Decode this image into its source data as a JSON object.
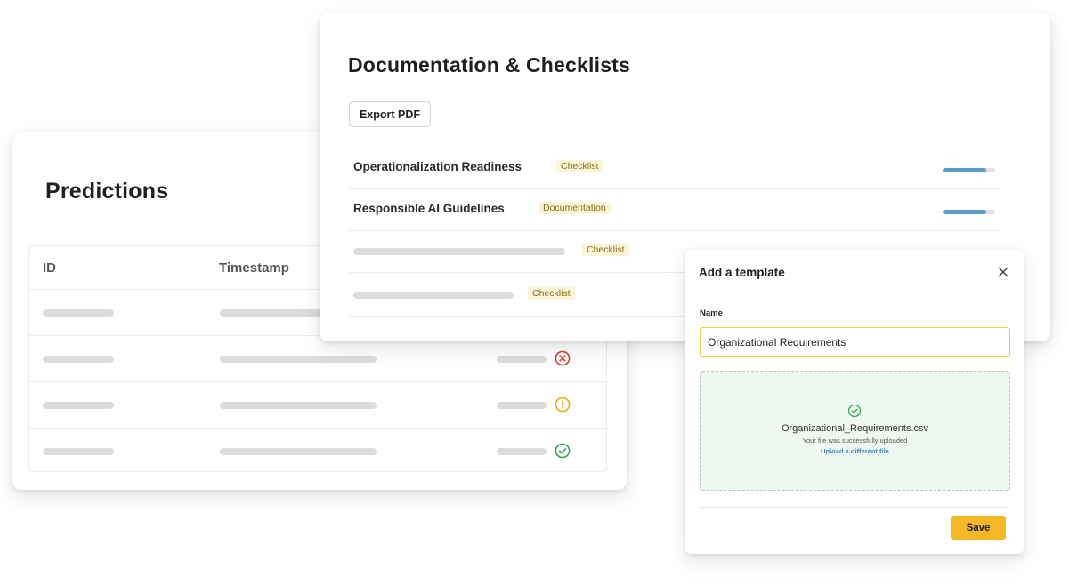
{
  "predictions": {
    "title": "Predictions",
    "columns": [
      "ID",
      "Timestamp"
    ],
    "rows": [
      {
        "status_icon": "none"
      },
      {
        "status_icon": "error-circle-icon"
      },
      {
        "status_icon": "warning-circle-icon"
      },
      {
        "status_icon": "check-circle-icon"
      }
    ]
  },
  "documentation": {
    "title": "Documentation & Checklists",
    "export_label": "Export PDF",
    "items": [
      {
        "label": "Operationalization Readiness",
        "tag": "Checklist",
        "progress": 0.83
      },
      {
        "label": "Responsible AI Guidelines",
        "tag": "Documentation",
        "progress": 0.83
      },
      {
        "label": "",
        "tag": "Checklist"
      },
      {
        "label": "",
        "tag": "Checklist"
      }
    ]
  },
  "modal": {
    "title": "Add a template",
    "name_label": "Name",
    "name_value": "Organizational Requirements",
    "file_name": "Organizational_Requirements.csv",
    "upload_message": "Your file was successfully uploaded",
    "upload_link": "Upload a different file",
    "save_label": "Save"
  },
  "colors": {
    "accent": "#f5b825",
    "progress": "#5b9bc4",
    "tag_bg": "#fdf5d9",
    "error": "#d23f2f",
    "warning": "#e8ad18",
    "success": "#3aa45a"
  }
}
